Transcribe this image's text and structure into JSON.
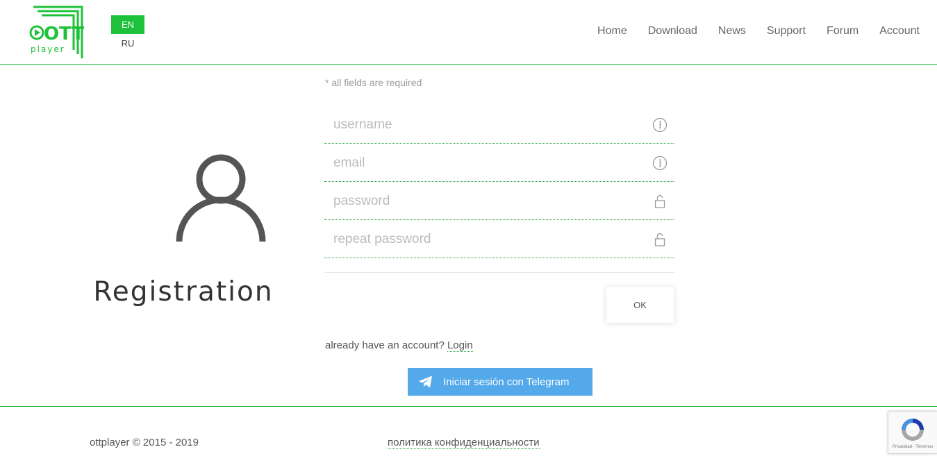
{
  "header": {
    "logo": {
      "text_main": "OTT",
      "text_sub": "player",
      "color": "#1ec23a"
    },
    "languages": [
      "EN",
      "RU"
    ],
    "active_language": "EN",
    "nav": [
      "Home",
      "Download",
      "News",
      "Support",
      "Forum",
      "Account"
    ]
  },
  "left": {
    "icon": "user-icon",
    "title": "Registration"
  },
  "form": {
    "required_note": "* all fields are required",
    "fields": [
      {
        "placeholder": "username",
        "value": "",
        "icon": "info-icon"
      },
      {
        "placeholder": "email",
        "value": "",
        "icon": "info-icon"
      },
      {
        "placeholder": "password",
        "value": "",
        "icon": "unlock-icon"
      },
      {
        "placeholder": "repeat password",
        "value": "",
        "icon": "unlock-icon"
      }
    ],
    "ok_label": "OK",
    "already_text": "already have an account?",
    "login_label": "Login",
    "telegram_label": "Iniciar sesión con Telegram"
  },
  "footer": {
    "copyright": "ottplayer © 2015 - 2019",
    "privacy": "политика конфиденциальности",
    "recaptcha_text": "Privacidad - Términos"
  },
  "colors": {
    "accent": "#1ec23a",
    "telegram": "#54a9eb"
  }
}
